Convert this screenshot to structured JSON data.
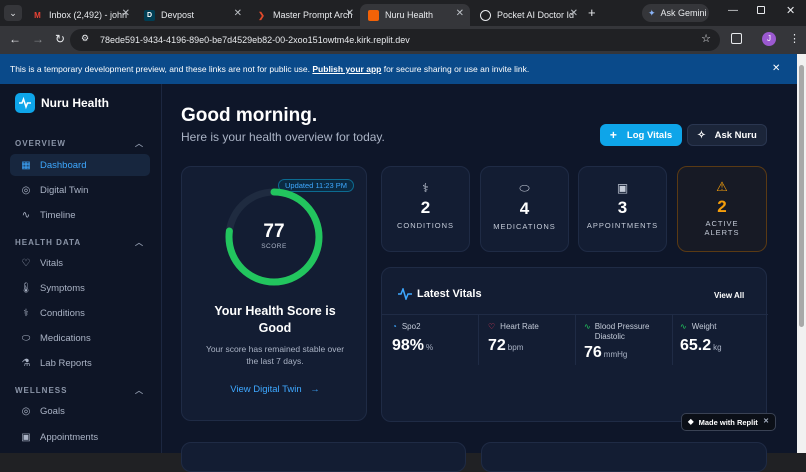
{
  "browser": {
    "tabs": [
      {
        "title": "Inbox (2,492) - john",
        "icon": "gmail-icon"
      },
      {
        "title": "Devpost",
        "icon": "devpost-icon"
      },
      {
        "title": "Master Prompt Arch",
        "icon": "arrow-icon"
      },
      {
        "title": "Nuru Health",
        "icon": "replit-icon"
      },
      {
        "title": "Pocket AI Doctor Id",
        "icon": "chatgpt-icon"
      }
    ],
    "ask_gemini": "Ask Gemini",
    "url": "78ede591-9434-4196-89e0-be7d4529eb82-00-2xoo151owtm4e.kirk.replit.dev",
    "profile_initial": "J"
  },
  "banner": {
    "text_before": "This is a temporary development preview, and these links are not for public use.",
    "link": "Publish your app",
    "text_after": "for secure sharing or use an invite link."
  },
  "sidebar": {
    "brand": "Nuru Health",
    "sections": [
      {
        "title": "OVERVIEW",
        "items": [
          "Dashboard",
          "Digital Twin",
          "Timeline"
        ]
      },
      {
        "title": "HEALTH DATA",
        "items": [
          "Vitals",
          "Symptoms",
          "Conditions",
          "Medications",
          "Lab Reports"
        ]
      },
      {
        "title": "WELLNESS",
        "items": [
          "Goals",
          "Appointments"
        ]
      }
    ]
  },
  "header": {
    "greeting": "Good morning.",
    "subtitle": "Here is your health overview for today.",
    "log_vitals": "Log Vitals",
    "ask_nuru": "Ask Nuru"
  },
  "score": {
    "updated": "Updated 11:23 PM",
    "value": "77",
    "label": "SCORE",
    "fraction": 0.77,
    "title": "Your Health Score is Good",
    "description": "Your score has remained stable over the last 7 days.",
    "link": "View Digital Twin"
  },
  "stats": [
    {
      "value": "2",
      "label": "CONDITIONS",
      "icon": "stethoscope-icon"
    },
    {
      "value": "4",
      "label": "MEDICATIONS",
      "icon": "pill-icon"
    },
    {
      "value": "3",
      "label": "APPOINTMENTS",
      "icon": "calendar-icon"
    },
    {
      "value": "2",
      "label": "ACTIVE ALERTS",
      "icon": "warning-icon"
    }
  ],
  "vitals": {
    "title": "Latest Vitals",
    "view_all": "View All",
    "items": [
      {
        "name": "Spo2",
        "value": "98%",
        "unit": "%"
      },
      {
        "name": "Heart Rate",
        "value": "72",
        "unit": "bpm"
      },
      {
        "name": "Blood Pressure Diastolic",
        "value": "76",
        "unit": "mmHg"
      },
      {
        "name": "Weight",
        "value": "65.2",
        "unit": "kg"
      }
    ]
  },
  "replit_badge": "Made with Replit",
  "colors": {
    "accent": "#0ea5e9",
    "score": "#22c55e",
    "alert": "#f59e0b"
  }
}
